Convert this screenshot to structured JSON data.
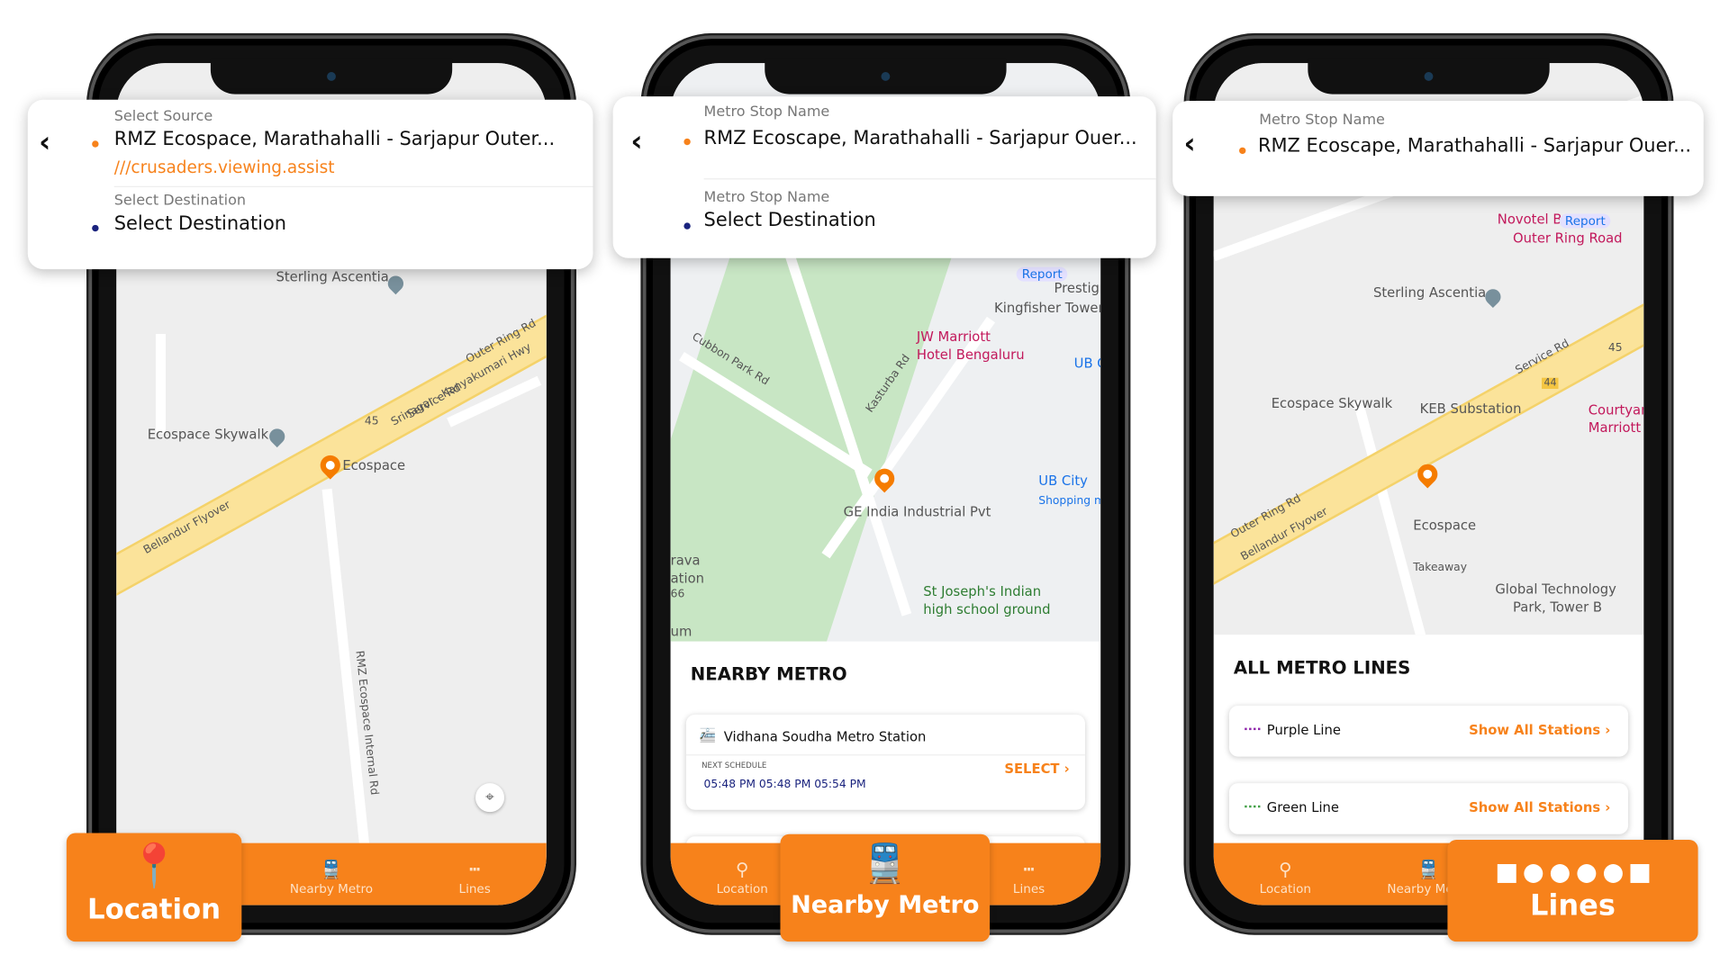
{
  "colors": {
    "accent": "#f7821b",
    "source_dot": "#f7821b",
    "dest_dot": "#1a237e"
  },
  "nav": {
    "location": "Location",
    "nearby": "Nearby Metro",
    "lines": "Lines"
  },
  "phone1": {
    "source_label": "Select Source",
    "source_value": "RMZ Ecospace, Marathahalli - Sarjapur Outer...",
    "w3w": "///crusaders.viewing.assist",
    "dest_label": "Select Destination",
    "dest_value": "Select Destination",
    "map_labels": [
      "Sterling Ascentia",
      "Ecospace Skywalk",
      "Ecospace",
      "Srinagar - Kanyakumari Hwy",
      "Outer Ring Rd",
      "Service Rd",
      "45",
      "Bellandur Flyover",
      "RMZ Ecospace Internal Rd"
    ]
  },
  "phone2": {
    "source_label": "Metro Stop Name",
    "source_value": "RMZ Ecoscape, Marathahalli - Sarjapur Ouer...",
    "dest_label": "Metro Stop Name",
    "dest_value": "Select Destination",
    "map_labels": [
      "Report",
      "Prestig",
      "Kingfisher Tower",
      "JW Marriott",
      "Hotel Bengaluru",
      "UB C",
      "Cubbon Park Rd",
      "Kasturba Rd",
      "GE India Industrial Pvt",
      "UB City",
      "Shopping m",
      "rava",
      "ation",
      "66",
      "St Joseph's Indian",
      "high school ground",
      "um"
    ],
    "sheet_title": "NEARBY METRO",
    "stations": [
      {
        "name": "Vidhana Soudha Metro Station",
        "schedule_label": "NEXT SCHEDULE",
        "times": "05:48 PM 05:48 PM 05:54 PM",
        "select": "SELECT"
      }
    ]
  },
  "phone3": {
    "source_label": "Metro Stop Name",
    "source_value": "RMZ Ecoscape, Marathahalli - Sarjapur Ouer...",
    "map_labels": [
      "Novotel B",
      "Report",
      "Outer Ring Road",
      "Sterling Ascentia",
      "Ecospace Skywalk",
      "KEB Substation",
      "Courtyar",
      "Marriott",
      "Ecospace",
      "Takeaway",
      "Global Technology",
      "Park, Tower B",
      "Outer Ring Rd",
      "Bellandur Flyover",
      "Service Rd",
      "45",
      "44"
    ],
    "sheet_title": "ALL METRO LINES",
    "lines": [
      {
        "name": "Purple Line",
        "color": "#8e24aa",
        "action": "Show All Stations"
      },
      {
        "name": "Green Line",
        "color": "#43a047",
        "action": "Show All Stations"
      }
    ]
  },
  "callouts": {
    "location": "Location",
    "nearby": "Nearby Metro",
    "lines": "Lines"
  }
}
